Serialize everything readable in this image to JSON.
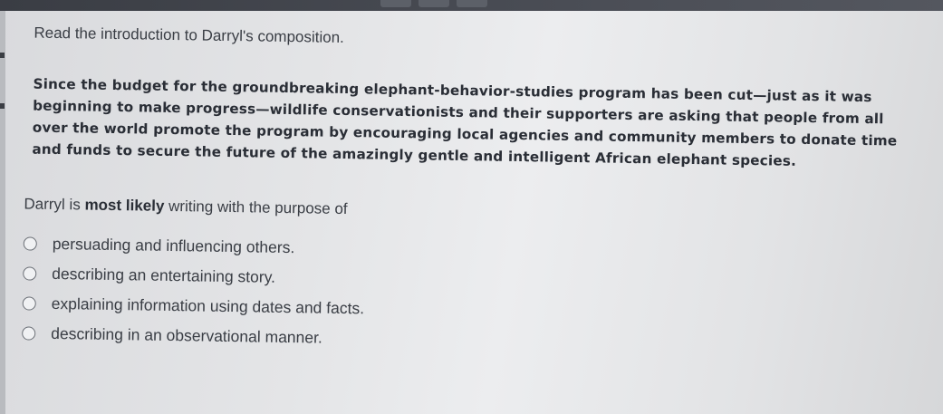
{
  "intro": "Read the introduction to Darryl's composition.",
  "passage_lines": [
    "Since the budget for the groundbreaking elephant-behavior-studies program has been cut—just as it was",
    "beginning to make progress—wildlife conservationists and their supporters are asking that people from all",
    "over the world promote the program by encouraging local agencies and community members to donate time",
    "and funds to secure the future of the amazingly gentle and intelligent African elephant species."
  ],
  "question": {
    "before": "Darryl is ",
    "emphasis": "most likely",
    "after": " writing with the purpose of"
  },
  "options": [
    "persuading and influencing others.",
    "describing an entertaining story.",
    "explaining information using dates and facts.",
    "describing in an observational manner."
  ]
}
